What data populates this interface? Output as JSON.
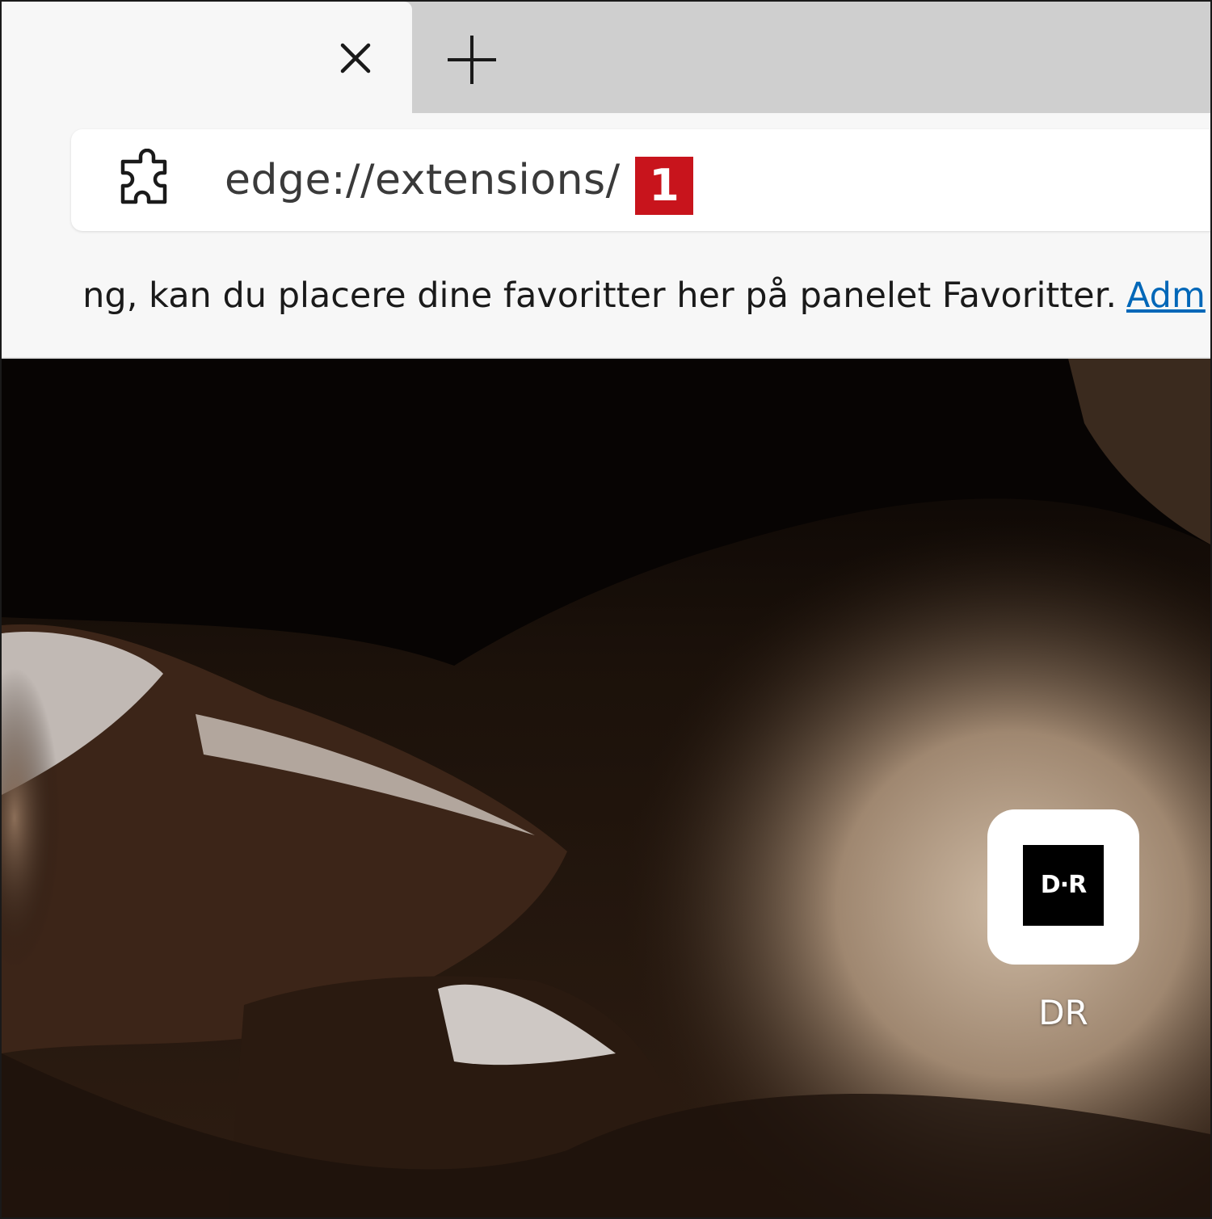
{
  "tabs": {
    "close_icon": "close-icon",
    "new_tab_icon": "plus-icon"
  },
  "address_bar": {
    "icon": "puzzle-icon",
    "url": "edge://extensions/",
    "badge": "1",
    "badge_color": "#c8141c"
  },
  "favorites_bar": {
    "message": "ng, kan du placere dine favoritter her på panelet Favoritter.",
    "link": "Adm"
  },
  "new_tab_page": {
    "tiles": [
      {
        "logo": "D·R",
        "label": "DR"
      }
    ]
  },
  "colors": {
    "link": "#0067b8",
    "tabstrip": "#cfcfcf",
    "toolbar": "#f7f7f7"
  }
}
